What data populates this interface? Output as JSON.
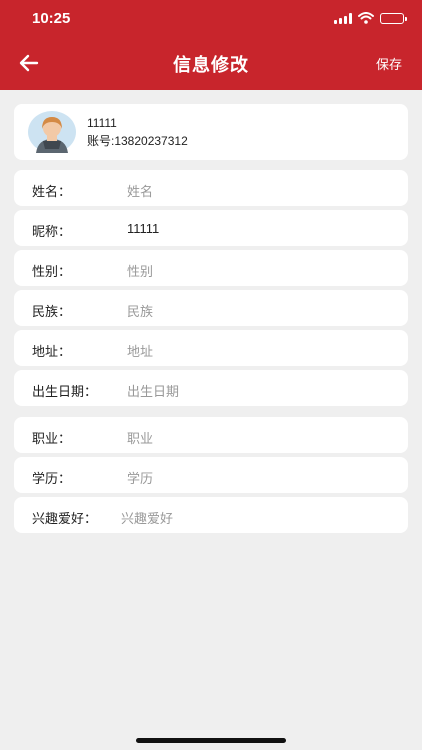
{
  "status_bar": {
    "time": "10:25"
  },
  "header": {
    "title": "信息修改",
    "save_label": "保存"
  },
  "profile": {
    "name": "11111",
    "account": "账号:13820237312"
  },
  "fields": [
    {
      "label": "姓名：",
      "value": "姓名"
    },
    {
      "label": "昵称：",
      "value": "11111"
    },
    {
      "label": "性别：",
      "value": "性别"
    },
    {
      "label": "民族：",
      "value": "民族"
    },
    {
      "label": "地址：",
      "value": "地址"
    },
    {
      "label": "出生日期：",
      "value": "出生日期"
    },
    {
      "label": "职业：",
      "value": "职业"
    },
    {
      "label": "学历：",
      "value": "学历"
    },
    {
      "label": "兴趣爱好：",
      "value": "兴趣爱好"
    }
  ],
  "colors": {
    "brand": "#c8252c",
    "background": "#efefef",
    "placeholder": "#999999"
  },
  "icons": {
    "back": "arrow-left-icon",
    "signal": "signal-icon",
    "wifi": "wifi-icon",
    "battery": "battery-icon",
    "avatar": "user-avatar"
  }
}
